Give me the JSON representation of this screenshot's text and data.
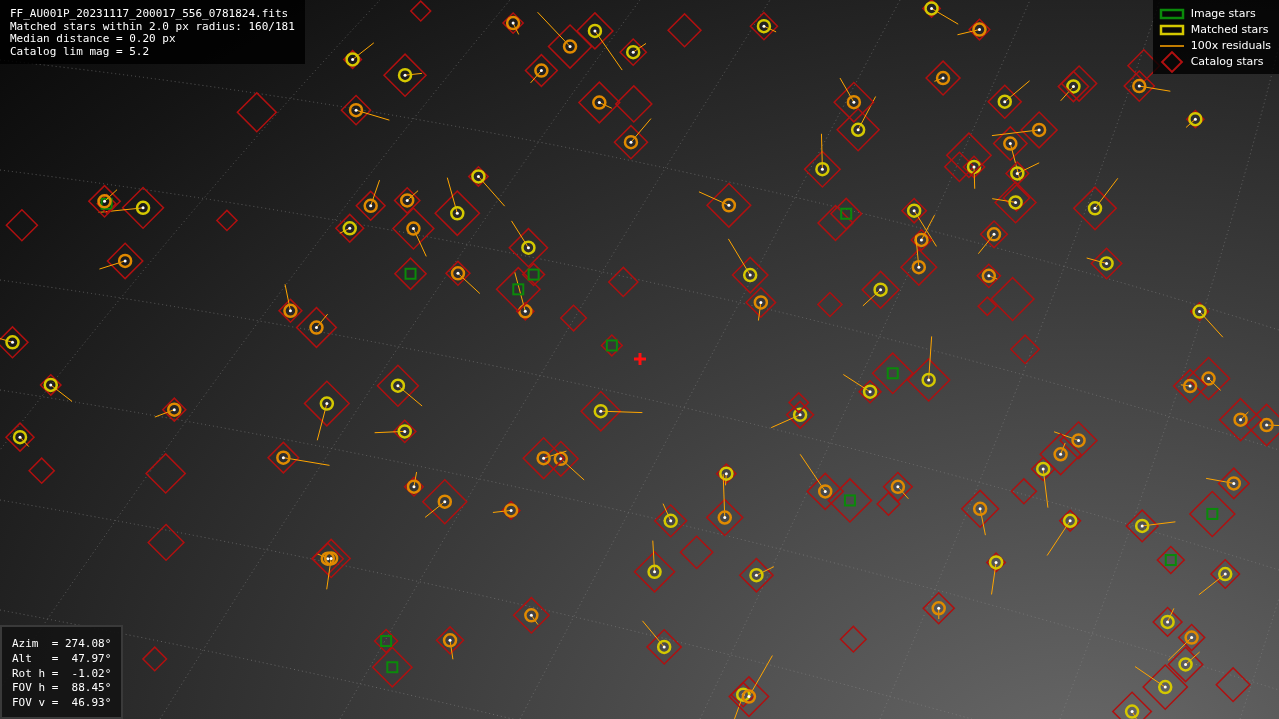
{
  "image_info": {
    "lines": [
      "FF_AU001P_20231117_200017_556_0781824.fits",
      "Matched stars within 2.0 px radius: 160/181",
      "Median distance = 0.20 px",
      "Catalog lim mag = 5.2"
    ]
  },
  "legend": [
    {
      "kind": "image",
      "label": "Image stars"
    },
    {
      "kind": "matched",
      "label": "Matched stars"
    },
    {
      "kind": "residual",
      "label": "100x residuals"
    },
    {
      "kind": "catalog",
      "label": "Catalog stars"
    }
  ],
  "pointing": {
    "lines": [
      "Azim  = 274.08°",
      "Alt   =  47.97°",
      "Rot h =  -1.02°",
      "FOV h =  88.45°",
      "FOV v =  46.93°"
    ]
  }
}
